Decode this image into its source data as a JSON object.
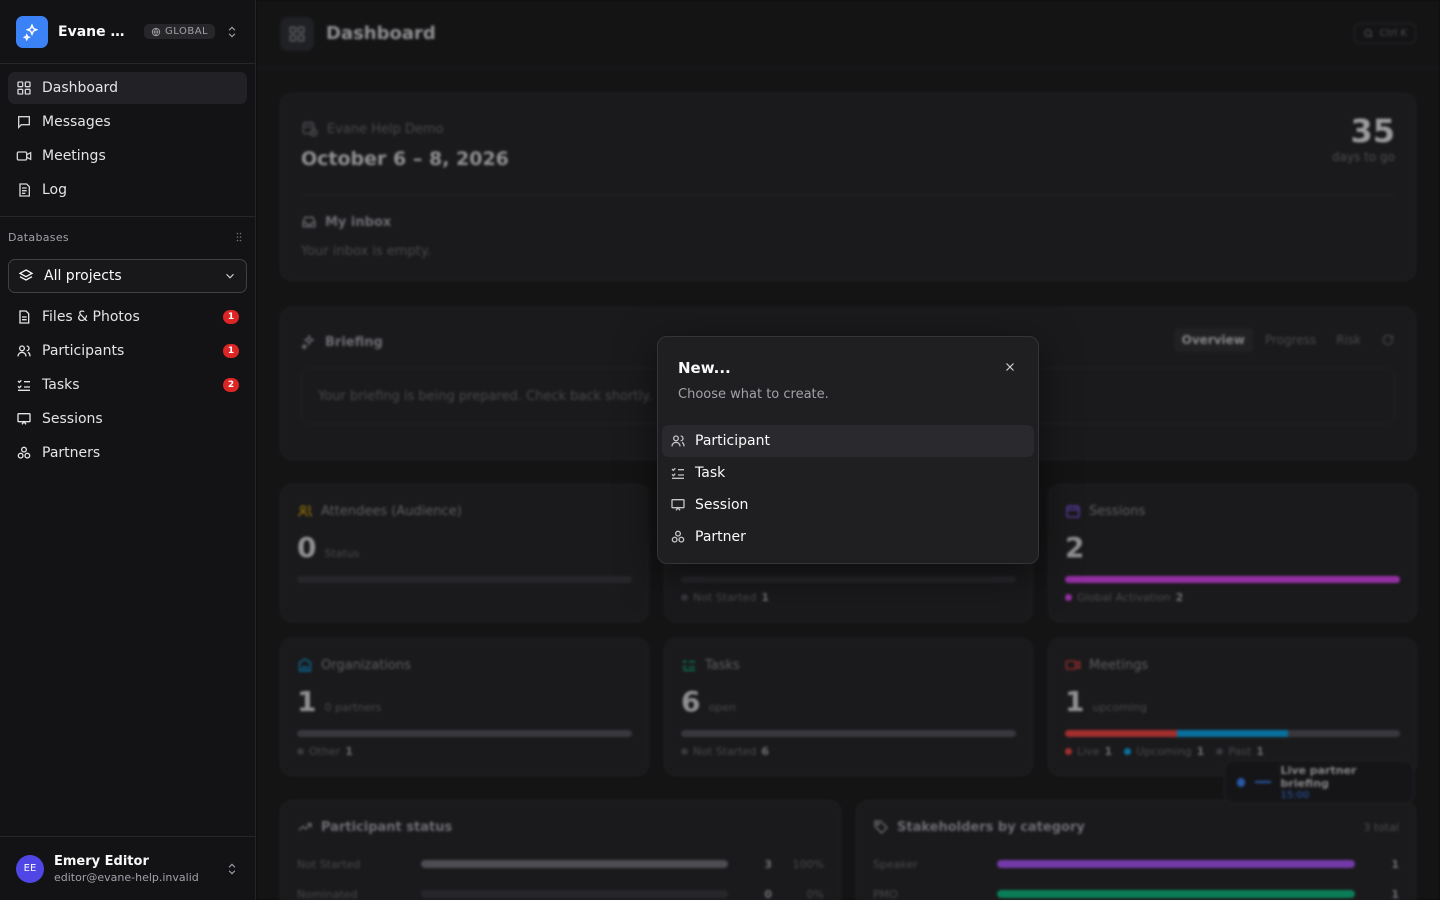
{
  "workspace": {
    "name": "Evane Help Demo",
    "badge": "GLOBAL"
  },
  "nav": [
    {
      "label": "Dashboard",
      "icon": "dashboard-icon",
      "active": true
    },
    {
      "label": "Messages",
      "icon": "message-icon"
    },
    {
      "label": "Meetings",
      "icon": "video-icon"
    },
    {
      "label": "Log",
      "icon": "log-icon"
    }
  ],
  "databases": {
    "heading": "Databases",
    "project_select": "All projects",
    "items": [
      {
        "label": "Files & Photos",
        "count": "1"
      },
      {
        "label": "Participants",
        "count": "1"
      },
      {
        "label": "Tasks",
        "count": "2"
      },
      {
        "label": "Sessions",
        "count": ""
      },
      {
        "label": "Partners",
        "count": ""
      }
    ]
  },
  "user": {
    "initials": "EE",
    "name": "Emery Editor",
    "email": "editor@evane-help.invalid"
  },
  "header": {
    "title": "Dashboard",
    "shortcut": "Ctrl K"
  },
  "event": {
    "name": "Evane Help Demo",
    "dates": "October 6 – 8, 2026",
    "days_count": "35",
    "days_label": "days to go",
    "inbox_title": "My inbox",
    "inbox_empty": "Your inbox is empty."
  },
  "briefing": {
    "title": "Briefing",
    "tabs": [
      "Overview",
      "Progress",
      "Risk"
    ],
    "message": "Your briefing is being prepared. Check back shortly."
  },
  "stats": {
    "attendees": {
      "title": "Attendees (Audience)",
      "value": "0",
      "unit": "Status"
    },
    "middle": {
      "legend_label": "Not Started",
      "legend_value": "1"
    },
    "sessions": {
      "title": "Sessions",
      "value": "2",
      "legend_label": "Global Activation",
      "legend_value": "2"
    },
    "organizations": {
      "title": "Organizations",
      "value": "1",
      "unit": "0 partners",
      "legend_label": "Other",
      "legend_value": "1"
    },
    "tasks": {
      "title": "Tasks",
      "value": "6",
      "unit": "open",
      "legend_label": "Not Started",
      "legend_value": "6"
    },
    "meetings": {
      "title": "Meetings",
      "value": "1",
      "unit": "upcoming",
      "legend": [
        {
          "label": "Live",
          "value": "1",
          "color": "#ef4444"
        },
        {
          "label": "Upcoming",
          "value": "1",
          "color": "#0ea5e9"
        },
        {
          "label": "Past",
          "value": "1",
          "color": "#52525b"
        }
      ]
    }
  },
  "participant_status": {
    "title": "Participant status",
    "rows": [
      {
        "label": "Not Started",
        "value": "3",
        "pct": "100%",
        "fraction": 1.0
      },
      {
        "label": "Nominated",
        "value": "0",
        "pct": "0%",
        "fraction": 0
      }
    ]
  },
  "stakeholders": {
    "title": "Stakeholders by category",
    "total": "3 total",
    "rows": [
      {
        "label": "Speaker",
        "value": "1",
        "color": "#a855f7",
        "fraction": 1.0
      },
      {
        "label": "PMO",
        "value": "1",
        "color": "#10b981",
        "fraction": 1.0
      }
    ]
  },
  "toast": {
    "label": "Live partner briefing",
    "time": "15:00"
  },
  "modal": {
    "title": "New...",
    "description": "Choose what to create.",
    "options": [
      "Participant",
      "Task",
      "Session",
      "Partner"
    ]
  },
  "colors": {
    "accent": "#3b82f6",
    "badge": "#dc2626",
    "sessions_bar": "#d946ef",
    "tasks_icon": "#10b981",
    "meetings_icon": "#ef4444"
  }
}
